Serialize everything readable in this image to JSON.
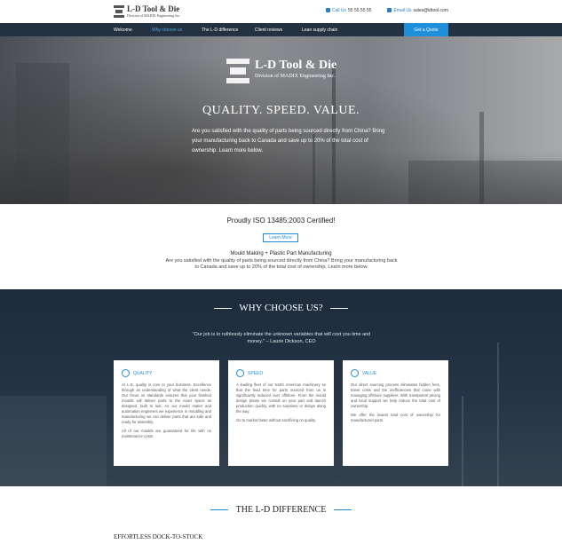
{
  "header": {
    "logo_name": "L-D Tool & Die",
    "logo_sub": "Division of MADIX Engineering Inc.",
    "call_label": "Call Us",
    "phone": "55 55 55 55",
    "email_label": "Email Us",
    "email": "sales@ldtool.com"
  },
  "nav": {
    "items": [
      {
        "label": "Welcome"
      },
      {
        "label": "Why choose us"
      },
      {
        "label": "The L-D difference"
      },
      {
        "label": "Client reviews"
      },
      {
        "label": "Lean supply chain"
      }
    ],
    "cta": "Get a Quote"
  },
  "hero": {
    "logo_name": "L-D Tool & Die",
    "logo_sub": "Division of MADIX Engineering Inc.",
    "title": "QUALITY. SPEED. VALUE.",
    "text": "Are you satisfied with the quality of parts being sourced directly from China? Bring your manufacturing back to Canada and save up to 20% of the total cost of ownership. Learn more below."
  },
  "iso": {
    "title": "Proudly ISO 13485:2003 Certified!",
    "button": "Learn More",
    "subtitle": "Mould Making + Plastic Part Manufacturing",
    "text": "Are you satisfied with the quality of parts being sourced directly from China? Bring your manufacturing back to Canada and save up to 20% of the total cost of ownership. Learn more below."
  },
  "why": {
    "title": "WHY CHOOSE US?",
    "quote": "\"Our job is to ruthlessly eliminate the unknown variables that will cost you time and money.\" – Laurie Dickson, CEO",
    "cards": [
      {
        "title": "QUALITY",
        "p1": "At L-D, quality is core to your business. Excellence through an understanding of what the client needs. Our focus on standards ensures that your finished moulds will deliver parts to the exact specs as designed, built to last. As our mould maker and automation engineers we experience in moulding and manufacturing we can deliver parts that are safe and ready for assembly.",
        "p2": "All of our moulds are guaranteed for life with no maintenance costs."
      },
      {
        "title": "SPEED",
        "p1": "A leading fleet of our North American machinery so that the lead time for parts sourced from us is significantly reduced over offshore. From the mould design phase we consult on your part and launch production quickly, with no surprises or delays along the way.",
        "p2": "Go to market faster without sacrificing on quality."
      },
      {
        "title": "VALUE",
        "p1": "Our direct sourcing process eliminates hidden fees, travel costs and the inefficiencies that come with managing offshore suppliers. With transparent pricing and local support we help reduce the total cost of ownership.",
        "p2": "We offer the lowest total cost of ownership for manufactured parts."
      }
    ]
  },
  "difference": {
    "title": "THE L-D DIFFERENCE",
    "subtitle": "EFFORTLESS DOCK-TO-STOCK"
  },
  "colors": {
    "accent": "#1f8fd9",
    "nav_bg": "#243140",
    "why_bg": "#1d2b3b"
  }
}
